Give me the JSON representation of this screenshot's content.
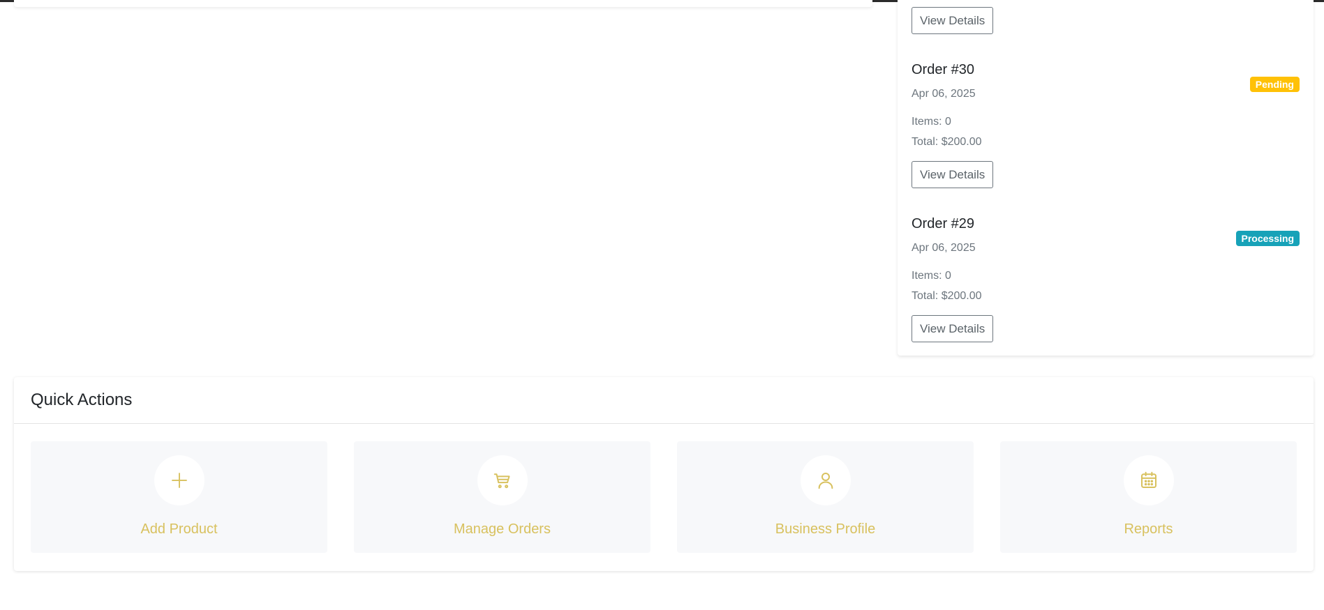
{
  "colors": {
    "accent": "#d8c15e",
    "pending": "#ffc107",
    "processing": "#17a2b8"
  },
  "orders": {
    "top_button_label": "View Details",
    "items": [
      {
        "title": "Order #30",
        "date": "Apr 06, 2025",
        "status": "Pending",
        "items_text": "Items: 0",
        "total_text": "Total: $200.00",
        "button_label": "View Details"
      },
      {
        "title": "Order #29",
        "date": "Apr 06, 2025",
        "status": "Processing",
        "items_text": "Items: 0",
        "total_text": "Total: $200.00",
        "button_label": "View Details"
      }
    ]
  },
  "quick_actions": {
    "title": "Quick Actions",
    "items": [
      {
        "label": "Add Product",
        "icon": "plus-icon"
      },
      {
        "label": "Manage Orders",
        "icon": "cart-icon"
      },
      {
        "label": "Business Profile",
        "icon": "user-icon"
      },
      {
        "label": "Reports",
        "icon": "calendar-icon"
      }
    ]
  }
}
